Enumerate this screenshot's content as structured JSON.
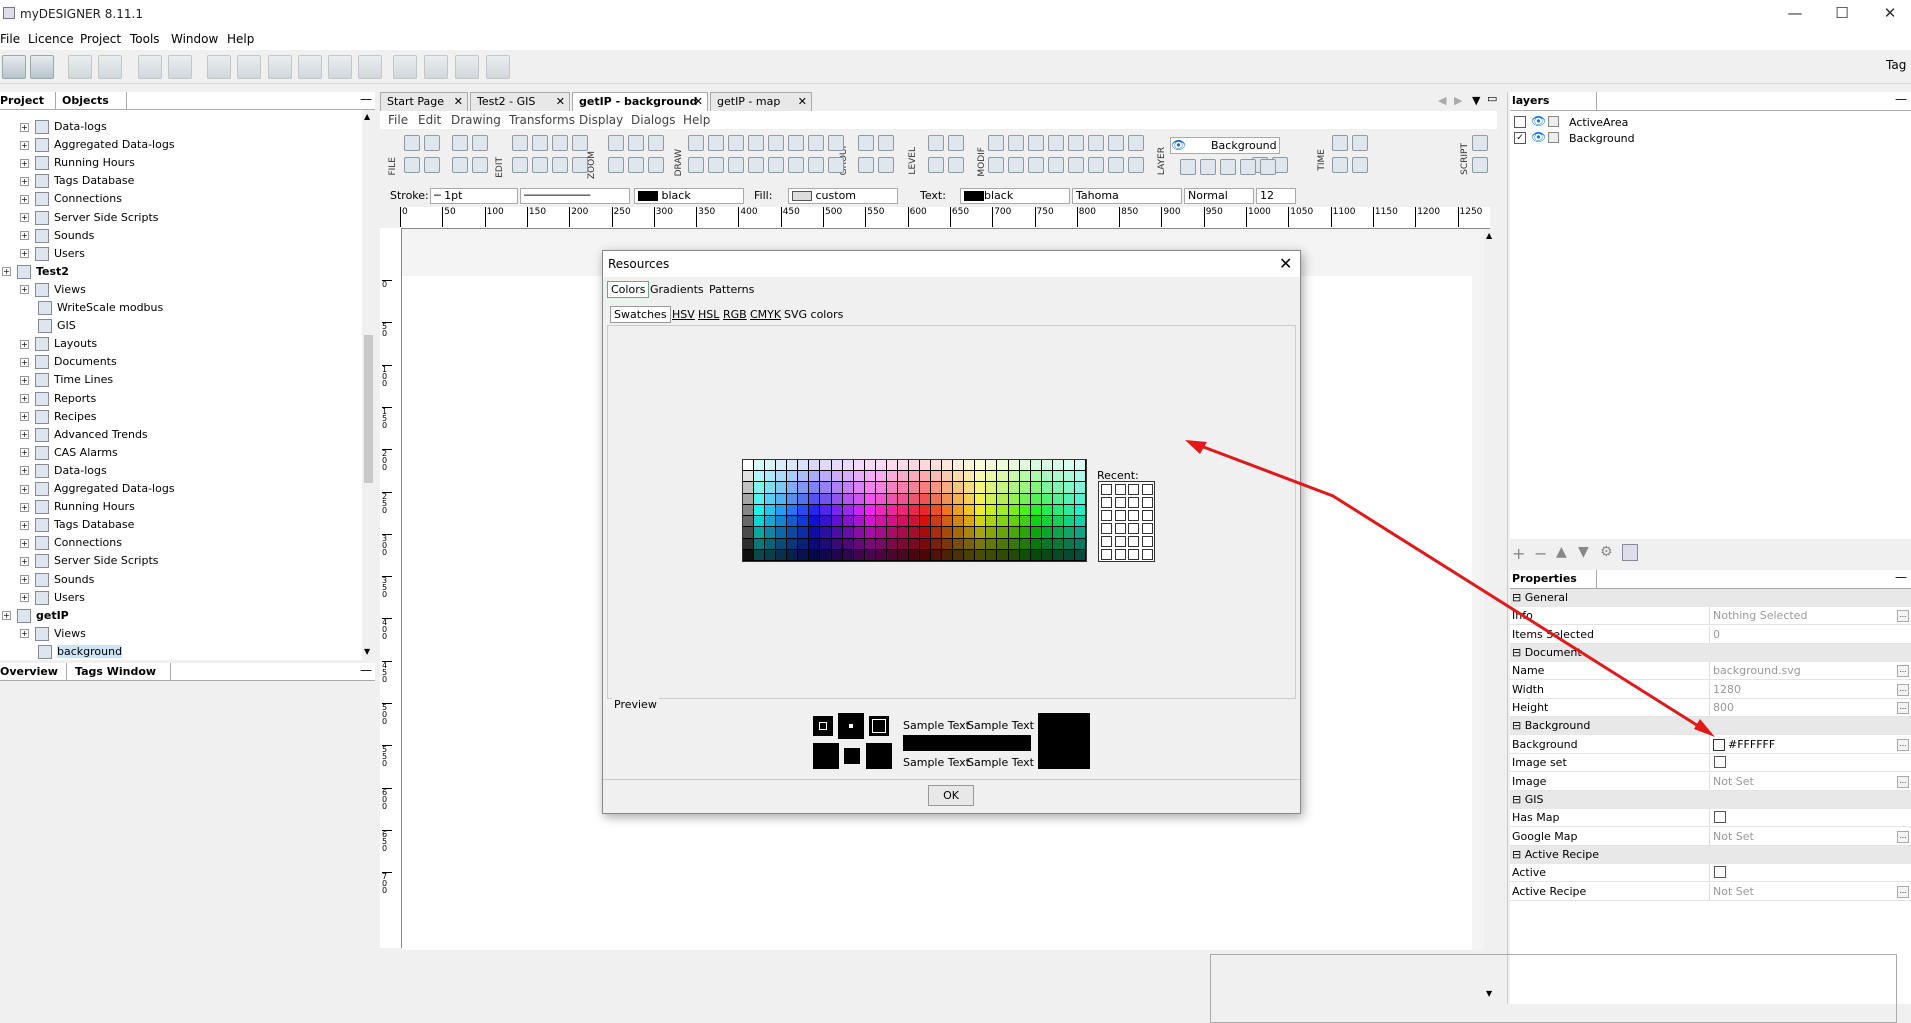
{
  "app": {
    "title": "myDESIGNER 8.11.1",
    "tag_label": "Tag"
  },
  "menu": [
    "File",
    "Licence",
    "Project",
    "Tools",
    "Window",
    "Help"
  ],
  "left_panel": {
    "tabs": [
      "Project",
      "Objects"
    ],
    "tree": [
      {
        "label": "Data-logs",
        "indent": 1
      },
      {
        "label": "Aggregated Data-logs",
        "indent": 1
      },
      {
        "label": "Running Hours",
        "indent": 1
      },
      {
        "label": "Tags Database",
        "indent": 1
      },
      {
        "label": "Connections",
        "indent": 1
      },
      {
        "label": "Server Side Scripts",
        "indent": 1
      },
      {
        "label": "Sounds",
        "indent": 1
      },
      {
        "label": "Users",
        "indent": 1
      },
      {
        "label": "Test2",
        "indent": 0
      },
      {
        "label": "Views",
        "indent": 1
      },
      {
        "label": "WriteScale modbus",
        "indent": 2
      },
      {
        "label": "GIS",
        "indent": 2
      },
      {
        "label": "Layouts",
        "indent": 1
      },
      {
        "label": "Documents",
        "indent": 1
      },
      {
        "label": "Time Lines",
        "indent": 1
      },
      {
        "label": "Reports",
        "indent": 1
      },
      {
        "label": "Recipes",
        "indent": 1
      },
      {
        "label": "Advanced Trends",
        "indent": 1
      },
      {
        "label": "CAS Alarms",
        "indent": 1
      },
      {
        "label": "Data-logs",
        "indent": 1
      },
      {
        "label": "Aggregated Data-logs",
        "indent": 1
      },
      {
        "label": "Running Hours",
        "indent": 1
      },
      {
        "label": "Tags Database",
        "indent": 1
      },
      {
        "label": "Connections",
        "indent": 1
      },
      {
        "label": "Server Side Scripts",
        "indent": 1
      },
      {
        "label": "Sounds",
        "indent": 1
      },
      {
        "label": "Users",
        "indent": 1
      },
      {
        "label": "getIP",
        "indent": 0
      },
      {
        "label": "Views",
        "indent": 1
      },
      {
        "label": "background",
        "indent": 2
      }
    ],
    "bottom_tabs": [
      "Overview",
      "Tags Window"
    ]
  },
  "doc_tabs": [
    "Start Page",
    "Test2 - GIS",
    "getIP - background",
    "getIP - map"
  ],
  "inner_menu": [
    "File",
    "Edit",
    "Drawing",
    "Transforms",
    "Display",
    "Dialogs",
    "Help"
  ],
  "tool_groups": [
    "FILE",
    "EDIT",
    "ZOOM",
    "DRAW",
    "GROUP",
    "LEVEL",
    "MODIF",
    "LAYER",
    "TIME",
    "SCRIPT"
  ],
  "layer_dropdown": "Background",
  "stylebar": {
    "stroke_label": "Stroke:",
    "stroke_width": "1pt",
    "stroke_color": "black",
    "fill_label": "Fill:",
    "fill_value": "custom",
    "text_label": "Text:",
    "text_color": "black",
    "font": "Tahoma",
    "weight": "Normal",
    "size": "12"
  },
  "ruler_labels": [
    "0",
    "50",
    "100",
    "150",
    "200",
    "250",
    "300",
    "350",
    "400",
    "450",
    "500",
    "550",
    "600",
    "650",
    "700",
    "750",
    "800",
    "850",
    "900",
    "950",
    "1000",
    "1050",
    "1100",
    "1150",
    "1200",
    "1250"
  ],
  "vruler_labels": [
    "0",
    "50",
    "100",
    "150",
    "200",
    "250",
    "300",
    "350",
    "400",
    "450",
    "500",
    "550",
    "600",
    "650",
    "700"
  ],
  "layers": {
    "title": "layers",
    "items": [
      {
        "name": "ActiveArea",
        "checked": false
      },
      {
        "name": "Background",
        "checked": true
      }
    ]
  },
  "properties": {
    "title": "Properties",
    "rows": [
      {
        "group": "General"
      },
      {
        "key": "Info",
        "value": "Nothing Selected",
        "dots": true
      },
      {
        "key": "Items Selected",
        "value": "0"
      },
      {
        "group": "Document"
      },
      {
        "key": "Name",
        "value": "background.svg",
        "dots": true
      },
      {
        "key": "Width",
        "value": "1280",
        "dots": true
      },
      {
        "key": "Height",
        "value": "800",
        "dots": true
      },
      {
        "group": "Background"
      },
      {
        "key": "Background",
        "value": "#FFFFFF",
        "swatch": true,
        "dots": true
      },
      {
        "key": "Image set",
        "checkbox": true
      },
      {
        "key": "Image",
        "value": "Not Set",
        "dots": true
      },
      {
        "group": "GIS"
      },
      {
        "key": "Has Map",
        "checkbox": true
      },
      {
        "key": "Google Map",
        "value": "Not Set",
        "dots": true
      },
      {
        "group": "Active Recipe"
      },
      {
        "key": "Active",
        "checkbox": true
      },
      {
        "key": "Active Recipe",
        "value": "Not Set",
        "dots": true
      }
    ]
  },
  "dialog": {
    "title": "Resources",
    "tabs": [
      "Colors",
      "Gradients",
      "Patterns"
    ],
    "subtabs": [
      "Swatches",
      "HSV",
      "HSL",
      "RGB",
      "CMYK",
      "SVG colors"
    ],
    "recent_label": "Recent:",
    "preview_label": "Preview",
    "sample_text": "Sample Text",
    "ok_label": "OK"
  },
  "annotation": {
    "arrow_color": "#e0191b"
  }
}
